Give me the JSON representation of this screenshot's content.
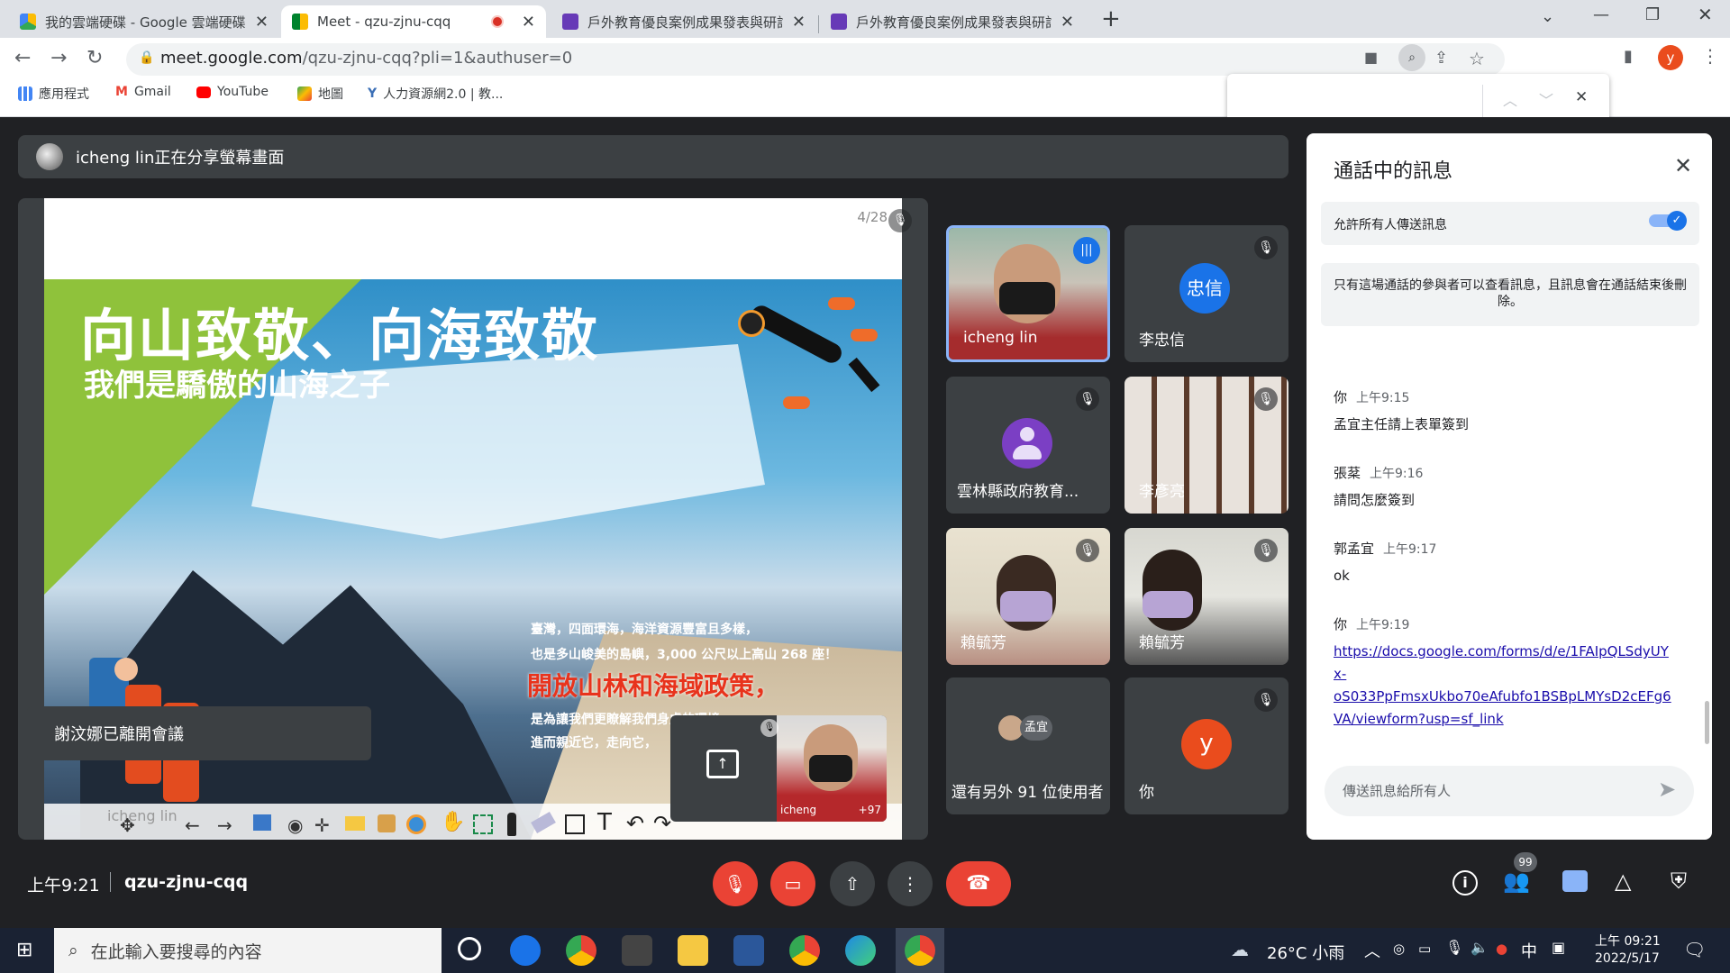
{
  "tabs": [
    {
      "title": "我的雲端硬碟 - Google 雲端硬碟",
      "active": false
    },
    {
      "title": "Meet - qzu-zjnu-cqq",
      "active": true
    },
    {
      "title": "戶外教育優良案例成果發表與研討",
      "active": false
    },
    {
      "title": "戶外教育優良案例成果發表與研討",
      "active": false
    }
  ],
  "address": {
    "host": "meet.google.com",
    "path": "/qzu-zjnu-cqq?pli=1&authuser=0",
    "profile": "y"
  },
  "bookmarks": [
    "應用程式",
    "Gmail",
    "YouTube",
    "地圖",
    "人力資源網2.0 | 教..."
  ],
  "banner": {
    "text": "icheng lin正在分享螢幕畫面"
  },
  "slide": {
    "page": "4/28",
    "title": "向山致敬、向海致敬",
    "subtitle": "我們是驕傲的山海之子",
    "body1": "臺灣，四面環海，海洋資源豐富且多樣，",
    "body2": "也是多山峻美的島嶼，3,000 公尺以上高山 268 座！",
    "headline": "開放山林和海域政策，",
    "body3": "是為讓我們更瞭解我們身處的環境",
    "body4": "進而親近它，走向它，",
    "presenter_label": "icheng lin"
  },
  "toast": "謝汶娜已離開會議",
  "self_preview": {
    "name": "icheng",
    "count": "+97"
  },
  "tiles": [
    {
      "name": "icheng lin",
      "speaking": true
    },
    {
      "name": "李忠信",
      "initials": "忠信",
      "color": "#1a73e8"
    },
    {
      "name": "雲林縣政府教育...",
      "initials": "",
      "color": "#7b3fc4"
    },
    {
      "name": "李彥亮"
    },
    {
      "name": "賴毓芳"
    },
    {
      "name": "賴毓芳"
    },
    {
      "name": "還有另外 91 位使用者",
      "avatar_label": "孟宜"
    },
    {
      "name": "你",
      "initials": "y",
      "color": "#ea4c1d"
    }
  ],
  "chat": {
    "title": "通話中的訊息",
    "allow_label": "允許所有人傳送訊息",
    "notice": "只有這場通話的參與者可以查看訊息，且訊息會在通話結束後刪除。",
    "messages": [
      {
        "who": "你",
        "time": "上午9:15",
        "text": "孟宜主任請上表單簽到"
      },
      {
        "who": "張棻",
        "time": "上午9:16",
        "text": "請問怎麼簽到"
      },
      {
        "who": "郭孟宜",
        "time": "上午9:17",
        "text": "ok"
      },
      {
        "who": "你",
        "time": "上午9:19",
        "link": "https://docs.google.com/forms/d/e/1FAIpQLSdyUYx-oS033PpFmsxUkbo70eAfubfo1BSBpLMYsD2cEFg6VA/viewform?usp=sf_link",
        "link_lines": [
          "https://docs.google.com/forms/d/e/1FAIpQLSdyUY",
          "x-",
          "oS033PpFmsxUkbo70eAfubfo1BSBpLMYsD2cEFg6",
          "VA/viewform?usp=sf_link"
        ]
      }
    ],
    "input_placeholder": "傳送訊息給所有人"
  },
  "footer": {
    "time": "上午9:21",
    "code": "qzu-zjnu-cqq",
    "people_badge": "99"
  },
  "taskbar": {
    "search_placeholder": "在此輸入要搜尋的內容",
    "weather": "26°C 小雨",
    "ime": "中",
    "clock_time": "上午 09:21",
    "clock_date": "2022/5/17"
  },
  "colors": {
    "meet_bg": "#202124",
    "tile_bg": "#3c4043",
    "red": "#ea4335",
    "blue": "#1a73e8"
  }
}
